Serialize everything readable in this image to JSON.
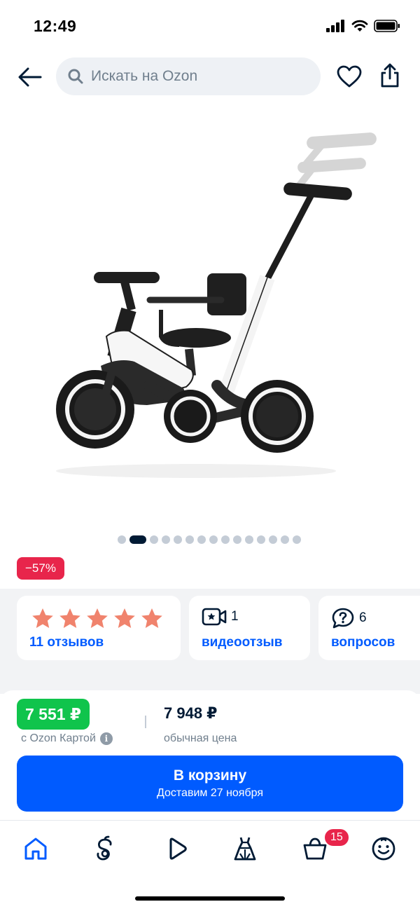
{
  "status_bar": {
    "time": "12:49"
  },
  "header": {
    "search_placeholder": "Искать на Ozon"
  },
  "gallery": {
    "total_slides": 15,
    "active_slide": 2
  },
  "discount_badge": "−57%",
  "reviews_card": {
    "rating_stars": 5,
    "link_label": "11 отзывов"
  },
  "video_card": {
    "count": "1",
    "link_label": "видеоотзыв"
  },
  "questions_card": {
    "count": "6",
    "link_label": "вопросов"
  },
  "price": {
    "ozon_card_price": "7 551 ₽",
    "ozon_card_label": "с Ozon Картой",
    "regular_price": "7 948 ₽",
    "regular_label": "обычная цена"
  },
  "cart_button": {
    "title": "В корзину",
    "subtitle": "Доставим 27 ноября"
  },
  "bottom_nav": {
    "items": [
      "home-icon",
      "catalog-icon",
      "video-icon",
      "fashion-icon",
      "cart-icon",
      "profile-icon"
    ],
    "cart_badge": "15",
    "active_color": "#005bff"
  },
  "colors": {
    "accent": "#005bff",
    "discount": "#e8254b",
    "ozon_price": "#10c44c",
    "star": "#f0836d"
  }
}
